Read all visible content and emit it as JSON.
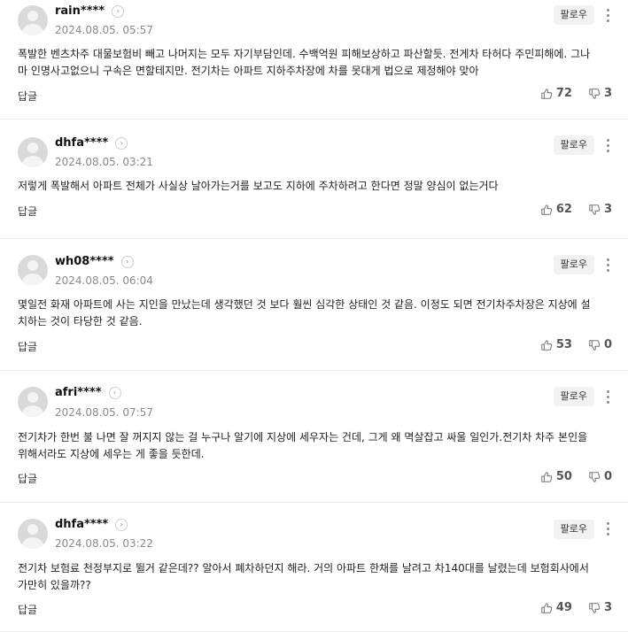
{
  "follow_label": "팔로우",
  "reply_label": "답글",
  "comments": [
    {
      "nickname": "rain****",
      "date": "2024.08.05. 05:57",
      "text": "폭발한 벤츠차주 대물보험비 빼고 나머지는 모두 자기부담인데. 수백억원 피해보상하고 파산할듯. 전게차 타허다 주민피해에. 그나마 인명사고없으니 구속은 면할테지만. 전기차는 아파트 지하주차장에 차를 못대게 법으로 제정해야 맞아",
      "likes": "72",
      "dislikes": "3"
    },
    {
      "nickname": "dhfa****",
      "date": "2024.08.05. 03:21",
      "text": "저렇게 폭발해서 아파트 전체가 사실상 날아가는거를 보고도 지하에 주차하려고 한다면 정말 양심이 없는거다",
      "likes": "62",
      "dislikes": "3"
    },
    {
      "nickname": "wh08****",
      "date": "2024.08.05. 06:04",
      "text": "몇일전 화재 아파트에 사는 지인을 만났는데 생각했던 것 보다 훨씬 심각한 상태인 것 같음. 이정도 되면 전기차주차장은 지상에 설치하는 것이 타당한 것 같음.",
      "likes": "53",
      "dislikes": "0"
    },
    {
      "nickname": "afri****",
      "date": "2024.08.05. 07:57",
      "text": "전기차가 한번 불 나면 잘 꺼지지 않는 걸 누구나 알기에 지상에 세우자는 건데, 그게 왜 멱살잡고 싸울 일인가.전기차 차주 본인을 위해서라도 지상에 세우는 게 좋을 듯한데.",
      "likes": "50",
      "dislikes": "0"
    },
    {
      "nickname": "dhfa****",
      "date": "2024.08.05. 03:22",
      "text": "전기차 보험료 천정부지로 뛸거 같은데?? 알아서 폐차하던지 해라. 거의 아파트 한채를 날려고 차140대를 날렸는데 보험회사에서 가만히 있을까??",
      "likes": "49",
      "dislikes": "3"
    }
  ]
}
